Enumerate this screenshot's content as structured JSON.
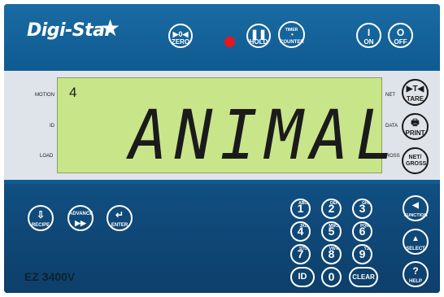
{
  "brand": {
    "logo": "Digi-Star",
    "star": "★"
  },
  "top_buttons": [
    {
      "name": "zero",
      "label": "ZERO",
      "sym": "▶0◀"
    },
    {
      "name": "hold",
      "label": "HOLD",
      "sym": "❚❚"
    },
    {
      "name": "timer-counter",
      "label": "COUNTER",
      "sym": "TIMER"
    },
    {
      "name": "on",
      "label": "ON",
      "sym": "I"
    },
    {
      "name": "off",
      "label": "OFF",
      "sym": "O"
    }
  ],
  "display": {
    "index": "4",
    "text": "ANIMAL"
  },
  "indicators_left": {
    "motion": "MOTION",
    "id": "ID",
    "load": "LOAD"
  },
  "indicators_right": {
    "net": "NET",
    "data": "DATA",
    "gross": "GROSS"
  },
  "right_buttons": [
    {
      "name": "tare",
      "label": "TARE",
      "sym": "▶T◀"
    },
    {
      "name": "print",
      "label": "PRINT",
      "sym": "🖶"
    },
    {
      "name": "net-gross",
      "label": "NET/ GROSS",
      "sym": ""
    }
  ],
  "left_controls": [
    {
      "name": "recipe",
      "label": "RECIPE",
      "sym": "⇩"
    },
    {
      "name": "advance",
      "label": "ADVANCE",
      "sym": "▶▶"
    },
    {
      "name": "enter",
      "label": "ENTER",
      "sym": "↵"
    }
  ],
  "keypad": [
    {
      "key": "1",
      "sub": "ABC"
    },
    {
      "key": "2",
      "sub": "DEF"
    },
    {
      "key": "3",
      "sub": "GHI"
    },
    {
      "key": "4",
      "sub": "JKL"
    },
    {
      "key": "5",
      "sub": "MNO"
    },
    {
      "key": "6",
      "sub": "PQR"
    },
    {
      "key": "7",
      "sub": "STU"
    },
    {
      "key": "8",
      "sub": "VWX"
    },
    {
      "key": "9",
      "sub": "YZ"
    },
    {
      "key": "ID",
      "sub": ""
    },
    {
      "key": "0",
      "sub": ""
    },
    {
      "key": "CLEAR",
      "sub": ""
    }
  ],
  "function_buttons": [
    {
      "name": "function",
      "label": "FUNCTION",
      "sym": "◀"
    },
    {
      "name": "select",
      "label": "SELECT",
      "sym": "▲"
    },
    {
      "name": "help",
      "label": "HELP",
      "sym": "?"
    }
  ],
  "model": "EZ 3400V",
  "colors": {
    "panel": "#0f5c92",
    "lcd": "#c8e58a",
    "led": "#e8151c"
  }
}
